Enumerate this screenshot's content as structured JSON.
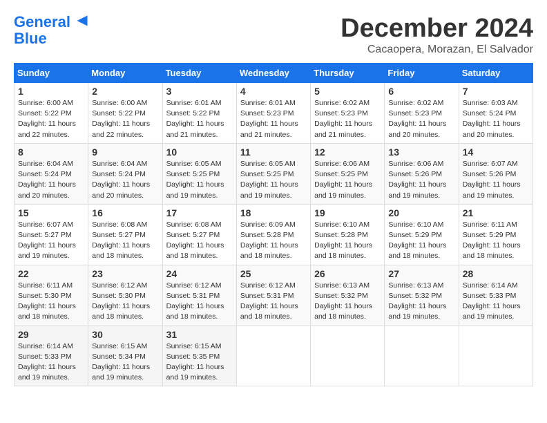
{
  "header": {
    "logo_line1": "General",
    "logo_line2": "Blue",
    "month_title": "December 2024",
    "subtitle": "Cacaopera, Morazan, El Salvador"
  },
  "weekdays": [
    "Sunday",
    "Monday",
    "Tuesday",
    "Wednesday",
    "Thursday",
    "Friday",
    "Saturday"
  ],
  "weeks": [
    [
      {
        "day": "1",
        "info": "Sunrise: 6:00 AM\nSunset: 5:22 PM\nDaylight: 11 hours\nand 22 minutes."
      },
      {
        "day": "2",
        "info": "Sunrise: 6:00 AM\nSunset: 5:22 PM\nDaylight: 11 hours\nand 22 minutes."
      },
      {
        "day": "3",
        "info": "Sunrise: 6:01 AM\nSunset: 5:22 PM\nDaylight: 11 hours\nand 21 minutes."
      },
      {
        "day": "4",
        "info": "Sunrise: 6:01 AM\nSunset: 5:23 PM\nDaylight: 11 hours\nand 21 minutes."
      },
      {
        "day": "5",
        "info": "Sunrise: 6:02 AM\nSunset: 5:23 PM\nDaylight: 11 hours\nand 21 minutes."
      },
      {
        "day": "6",
        "info": "Sunrise: 6:02 AM\nSunset: 5:23 PM\nDaylight: 11 hours\nand 20 minutes."
      },
      {
        "day": "7",
        "info": "Sunrise: 6:03 AM\nSunset: 5:24 PM\nDaylight: 11 hours\nand 20 minutes."
      }
    ],
    [
      {
        "day": "8",
        "info": "Sunrise: 6:04 AM\nSunset: 5:24 PM\nDaylight: 11 hours\nand 20 minutes."
      },
      {
        "day": "9",
        "info": "Sunrise: 6:04 AM\nSunset: 5:24 PM\nDaylight: 11 hours\nand 20 minutes."
      },
      {
        "day": "10",
        "info": "Sunrise: 6:05 AM\nSunset: 5:25 PM\nDaylight: 11 hours\nand 19 minutes."
      },
      {
        "day": "11",
        "info": "Sunrise: 6:05 AM\nSunset: 5:25 PM\nDaylight: 11 hours\nand 19 minutes."
      },
      {
        "day": "12",
        "info": "Sunrise: 6:06 AM\nSunset: 5:25 PM\nDaylight: 11 hours\nand 19 minutes."
      },
      {
        "day": "13",
        "info": "Sunrise: 6:06 AM\nSunset: 5:26 PM\nDaylight: 11 hours\nand 19 minutes."
      },
      {
        "day": "14",
        "info": "Sunrise: 6:07 AM\nSunset: 5:26 PM\nDaylight: 11 hours\nand 19 minutes."
      }
    ],
    [
      {
        "day": "15",
        "info": "Sunrise: 6:07 AM\nSunset: 5:27 PM\nDaylight: 11 hours\nand 19 minutes."
      },
      {
        "day": "16",
        "info": "Sunrise: 6:08 AM\nSunset: 5:27 PM\nDaylight: 11 hours\nand 18 minutes."
      },
      {
        "day": "17",
        "info": "Sunrise: 6:08 AM\nSunset: 5:27 PM\nDaylight: 11 hours\nand 18 minutes."
      },
      {
        "day": "18",
        "info": "Sunrise: 6:09 AM\nSunset: 5:28 PM\nDaylight: 11 hours\nand 18 minutes."
      },
      {
        "day": "19",
        "info": "Sunrise: 6:10 AM\nSunset: 5:28 PM\nDaylight: 11 hours\nand 18 minutes."
      },
      {
        "day": "20",
        "info": "Sunrise: 6:10 AM\nSunset: 5:29 PM\nDaylight: 11 hours\nand 18 minutes."
      },
      {
        "day": "21",
        "info": "Sunrise: 6:11 AM\nSunset: 5:29 PM\nDaylight: 11 hours\nand 18 minutes."
      }
    ],
    [
      {
        "day": "22",
        "info": "Sunrise: 6:11 AM\nSunset: 5:30 PM\nDaylight: 11 hours\nand 18 minutes."
      },
      {
        "day": "23",
        "info": "Sunrise: 6:12 AM\nSunset: 5:30 PM\nDaylight: 11 hours\nand 18 minutes."
      },
      {
        "day": "24",
        "info": "Sunrise: 6:12 AM\nSunset: 5:31 PM\nDaylight: 11 hours\nand 18 minutes."
      },
      {
        "day": "25",
        "info": "Sunrise: 6:12 AM\nSunset: 5:31 PM\nDaylight: 11 hours\nand 18 minutes."
      },
      {
        "day": "26",
        "info": "Sunrise: 6:13 AM\nSunset: 5:32 PM\nDaylight: 11 hours\nand 18 minutes."
      },
      {
        "day": "27",
        "info": "Sunrise: 6:13 AM\nSunset: 5:32 PM\nDaylight: 11 hours\nand 19 minutes."
      },
      {
        "day": "28",
        "info": "Sunrise: 6:14 AM\nSunset: 5:33 PM\nDaylight: 11 hours\nand 19 minutes."
      }
    ],
    [
      {
        "day": "29",
        "info": "Sunrise: 6:14 AM\nSunset: 5:33 PM\nDaylight: 11 hours\nand 19 minutes."
      },
      {
        "day": "30",
        "info": "Sunrise: 6:15 AM\nSunset: 5:34 PM\nDaylight: 11 hours\nand 19 minutes."
      },
      {
        "day": "31",
        "info": "Sunrise: 6:15 AM\nSunset: 5:35 PM\nDaylight: 11 hours\nand 19 minutes."
      },
      null,
      null,
      null,
      null
    ]
  ]
}
